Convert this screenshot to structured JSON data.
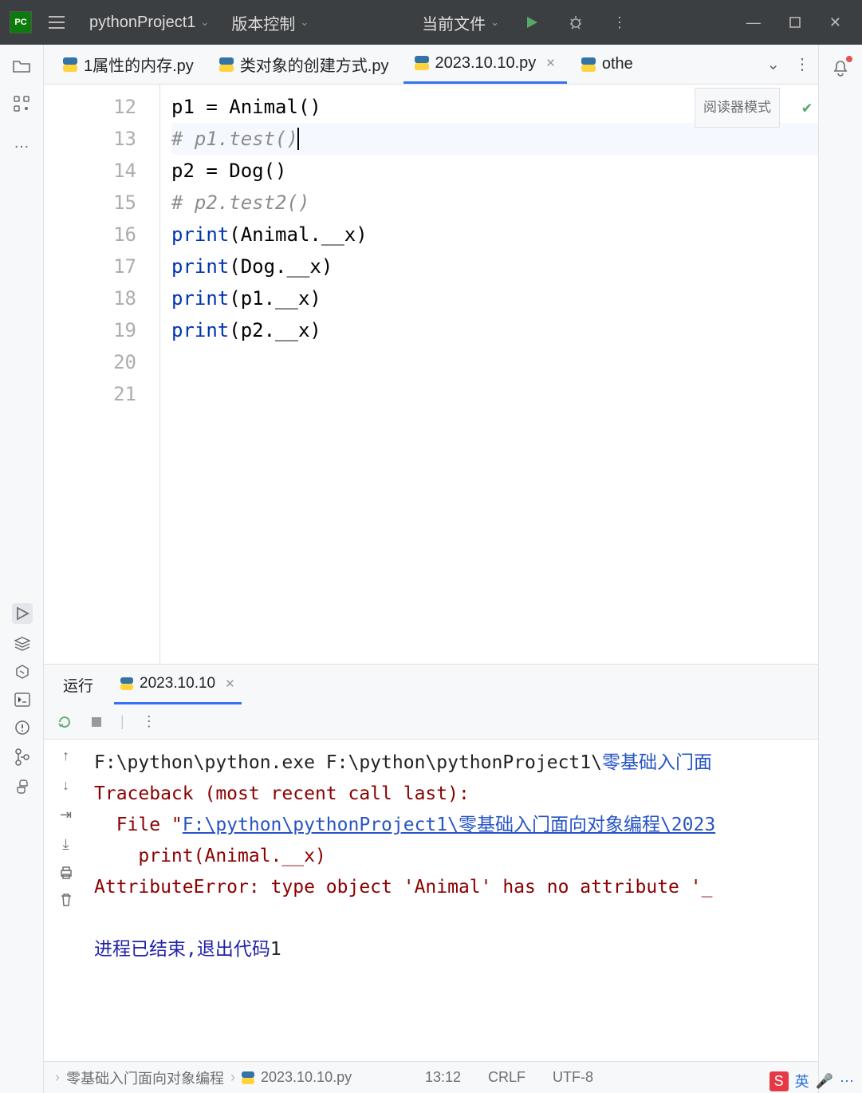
{
  "titlebar": {
    "logo": "PC",
    "project": "pythonProject1",
    "vcs": "版本控制",
    "run_target": "当前文件"
  },
  "tabs": [
    {
      "label": "1属性的内存.py"
    },
    {
      "label": "类对象的创建方式.py"
    },
    {
      "label": "2023.10.10.py",
      "active": true
    },
    {
      "label": "othe"
    }
  ],
  "editor": {
    "reader_mode": "阅读器模式",
    "lines": [
      {
        "n": "12",
        "html": "p1 = Animal()"
      },
      {
        "n": "13",
        "html": "<span class='c-comment'># p1.test()</span>",
        "cursor": true
      },
      {
        "n": "14",
        "html": ""
      },
      {
        "n": "15",
        "html": "p2 = Dog()"
      },
      {
        "n": "16",
        "html": "<span class='c-comment'># p2.test2()</span>"
      },
      {
        "n": "17",
        "html": ""
      },
      {
        "n": "18",
        "html": "<span class='c-kw'>print</span>(Animal.__x)"
      },
      {
        "n": "19",
        "html": "<span class='c-kw'>print</span>(Dog.__x)"
      },
      {
        "n": "20",
        "html": "<span class='c-kw'>print</span>(p1.__x)"
      },
      {
        "n": "21",
        "html": "<span class='c-kw'>print</span>(p2.__x)"
      }
    ]
  },
  "run_panel": {
    "title": "运行",
    "tab": "2023.10.10",
    "console": [
      {
        "html": "<span class='c-path'>F:\\python\\python.exe F:\\python\\pythonProject1\\</span><span class='c-blue'>零基础入门面</span>"
      },
      {
        "html": "<span class='c-err'>Traceback (most recent call last):</span>"
      },
      {
        "html": "<span class='c-err'>  File \"</span><span class='c-link'>F:\\python\\pythonProject1\\零基础入门面向对象编程\\2023</span>"
      },
      {
        "html": "<span class='c-err'>    print(Animal.__x)</span>"
      },
      {
        "html": "<span class='c-err'>AttributeError: type object 'Animal' has no attribute '_</span>"
      },
      {
        "html": ""
      },
      {
        "html": "<span class='c-exit'>进程已结束,退出代码</span>1"
      }
    ]
  },
  "statusbar": {
    "breadcrumb1": "零基础入门面向对象编程",
    "breadcrumb2": "2023.10.10.py",
    "pos": "13:12",
    "eol": "CRLF",
    "enc": "UTF-8"
  },
  "ime": {
    "lang": "英"
  }
}
